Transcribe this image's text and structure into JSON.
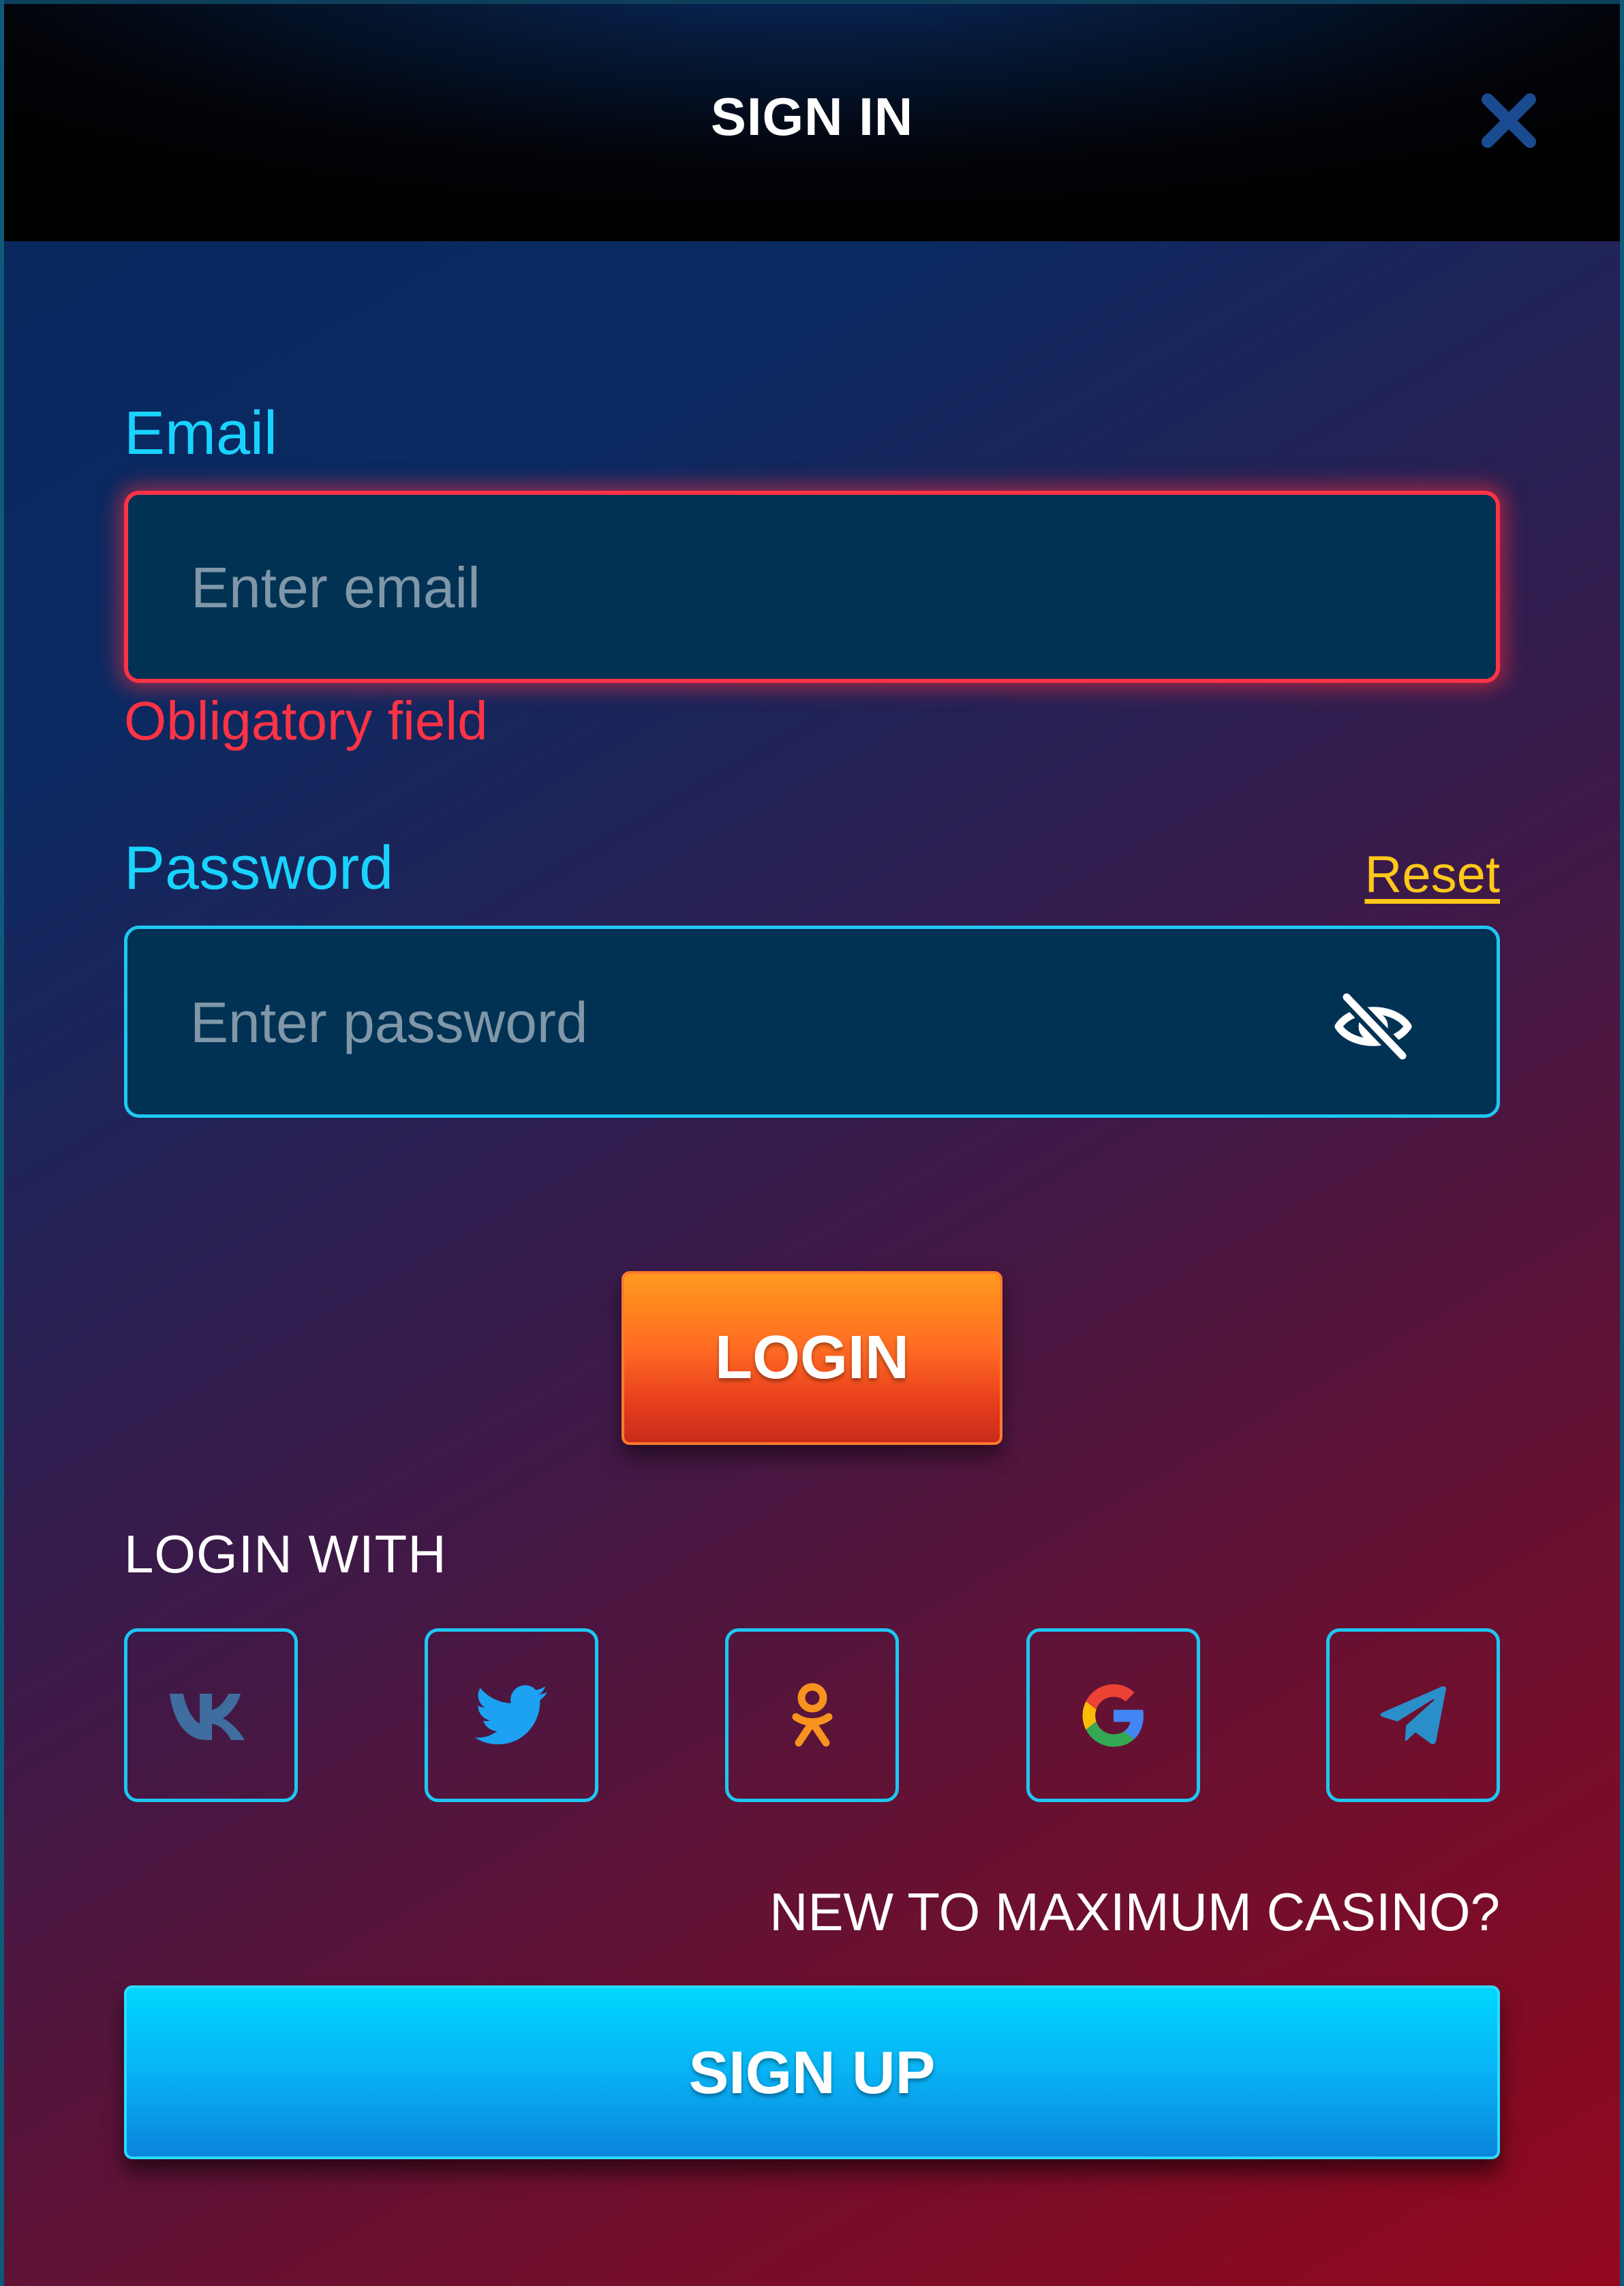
{
  "header": {
    "title": "SIGN IN",
    "close_icon": "close-icon"
  },
  "email": {
    "label": "Email",
    "placeholder": "Enter email",
    "value": "",
    "error": "Obligatory field"
  },
  "password": {
    "label": "Password",
    "placeholder": "Enter password",
    "value": "",
    "reset_label": "Reset",
    "toggle_icon": "eye-slash-icon"
  },
  "login_button": "LOGIN",
  "social": {
    "title": "LOGIN WITH",
    "providers": [
      {
        "name": "VK",
        "icon": "vk-icon",
        "color": "#3f6d9f"
      },
      {
        "name": "Twitter",
        "icon": "twitter-icon",
        "color": "#1da1f2"
      },
      {
        "name": "Odnoklassniki",
        "icon": "odnoklassniki-icon",
        "color": "#f7931e"
      },
      {
        "name": "Google",
        "icon": "google-icon",
        "color": "#4285f4"
      },
      {
        "name": "Telegram",
        "icon": "telegram-icon",
        "color": "#2a8ec9"
      }
    ]
  },
  "signup": {
    "prompt": "NEW TO MAXIMUM CASINO?",
    "button": "SIGN UP"
  },
  "colors": {
    "accent_cyan": "#19d3ff",
    "error_red": "#ff3345",
    "link_yellow": "#ffc81a",
    "login_orange": "#ff6a22",
    "signup_blue": "#08b2f4"
  }
}
